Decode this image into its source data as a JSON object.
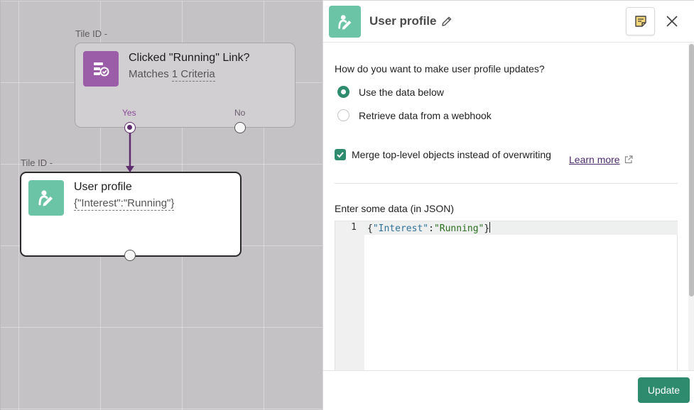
{
  "canvas": {
    "decision_tile": {
      "tile_id_label": "Tile ID -",
      "title": "Clicked \"Running\" Link?",
      "subtitle_prefix": "Matches ",
      "subtitle_link": "1 Criteria",
      "yes_label": "Yes",
      "no_label": "No",
      "icon": "split-decision-icon",
      "icon_color": "#9b5ca8"
    },
    "profile_tile": {
      "tile_id_label": "Tile ID -",
      "title": "User profile",
      "subtitle": "{\"Interest\":\"Running\"}",
      "icon": "user-profile-icon",
      "icon_color": "#6cc4a6"
    }
  },
  "panel": {
    "title": "User profile",
    "header_icon": "user-profile-icon",
    "edit_icon": "pencil-icon",
    "notes_icon": "note-icon",
    "close_icon": "close-icon",
    "question": "How do you want to make user profile updates?",
    "options": [
      {
        "label": "Use the data below",
        "checked": true
      },
      {
        "label": "Retrieve data from a webhook",
        "checked": false
      }
    ],
    "merge_checkbox": {
      "label": "Merge top-level objects instead of overwriting",
      "checked": true
    },
    "learn_more": "Learn more",
    "json_label": "Enter some data (in JSON)",
    "editor": {
      "line_number": "1",
      "tokens": {
        "open": "{",
        "key": "\"Interest\"",
        "colon": ":",
        "value": "\"Running\"",
        "close": "}"
      }
    },
    "update_button": "Update",
    "accent_color": "#2e8b6e"
  }
}
